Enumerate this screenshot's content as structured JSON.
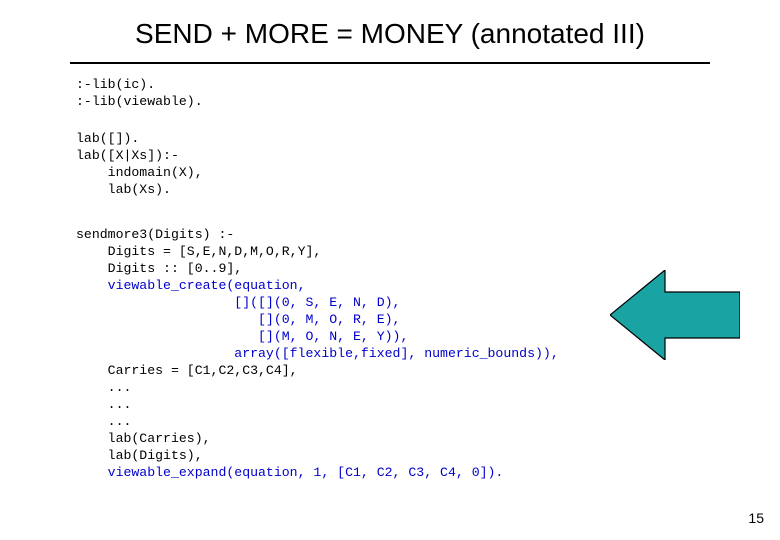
{
  "title": "SEND + MORE = MONEY (annotated III)",
  "code": {
    "block1_l1": ":-lib(ic).",
    "block1_l2": ":-lib(viewable).",
    "block2_l1": "lab([]).",
    "block2_l2": "lab([X|Xs]):-",
    "block2_l3": "    indomain(X),",
    "block2_l4": "    lab(Xs).",
    "block3_l1": "sendmore3(Digits) :-",
    "block3_l2": "    Digits = [S,E,N,D,M,O,R,Y],",
    "block3_l3": "    Digits :: [0..9],",
    "block3_lead": "    ",
    "block3_l4_blue": "viewable_create(equation,",
    "block3_l5_blue": "                    []([](0, S, E, N, D),",
    "block3_l6_blue": "                       [](0, M, O, R, E),",
    "block3_l7_blue": "                       [](M, O, N, E, Y)),",
    "block3_l8_blue": "                    array([flexible,fixed], numeric_bounds)),",
    "block3_l9": "Carries = [C1,C2,C3,C4],",
    "block3_l10": "...",
    "block3_l11": "...",
    "block3_l12": "...",
    "block3_l13": "lab(Carries),",
    "block3_l14": "lab(Digits),",
    "block3_l15_blue": "viewable_expand(equation, 1, [C1, C2, C3, C4, 0])."
  },
  "arrow": {
    "fill": "#1aa3a3",
    "stroke": "#000000"
  },
  "pagenum": "15"
}
